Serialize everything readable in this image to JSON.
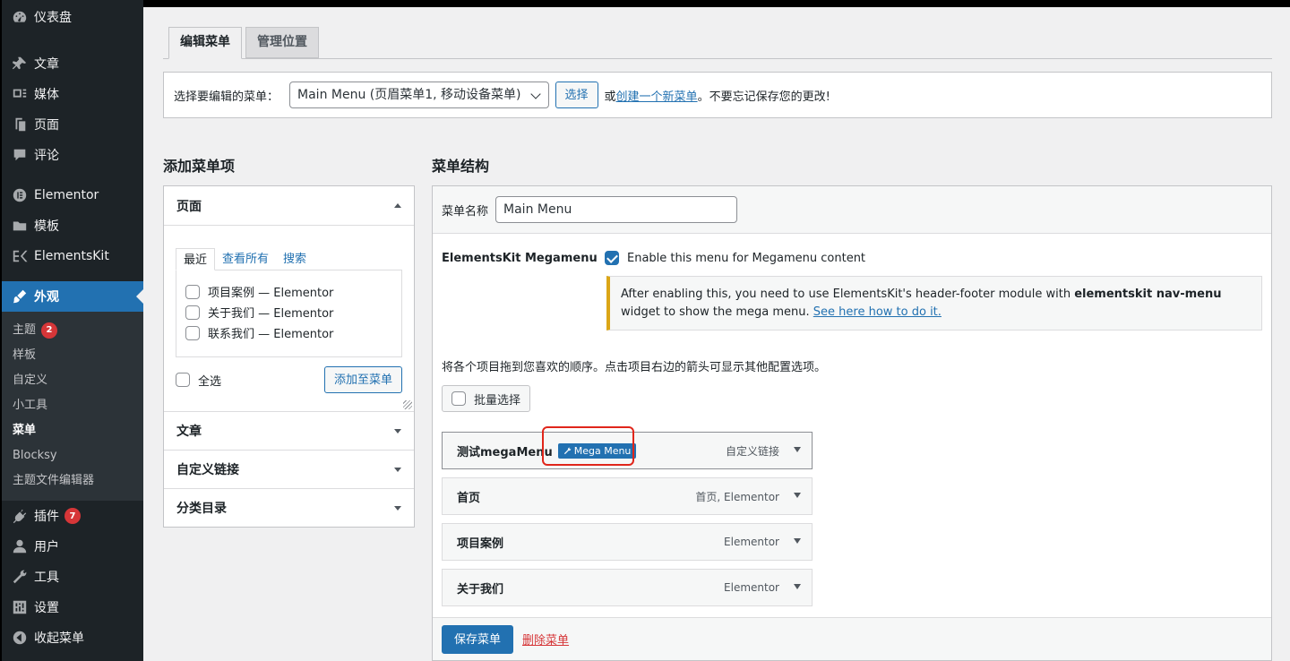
{
  "sidebar": {
    "items": [
      {
        "label": "仪表盘",
        "icon": "dashboard-icon"
      },
      {
        "label": "文章",
        "icon": "pin-icon"
      },
      {
        "label": "媒体",
        "icon": "media-icon"
      },
      {
        "label": "页面",
        "icon": "page-icon"
      },
      {
        "label": "评论",
        "icon": "comment-icon"
      },
      {
        "label": "Elementor",
        "icon": "elementor-icon"
      },
      {
        "label": "模板",
        "icon": "folder-icon"
      },
      {
        "label": "ElementsKit",
        "icon": "elementskit-icon"
      },
      {
        "label": "外观",
        "icon": "brush-icon"
      }
    ],
    "submenu": [
      {
        "label": "主题",
        "badge": "2"
      },
      {
        "label": "样板"
      },
      {
        "label": "自定义"
      },
      {
        "label": "小工具"
      },
      {
        "label": "菜单"
      },
      {
        "label": "Blocksy"
      },
      {
        "label": "主题文件编辑器"
      }
    ],
    "bottom_items": [
      {
        "label": "插件",
        "icon": "plugin-icon",
        "badge": "7"
      },
      {
        "label": "用户",
        "icon": "user-icon"
      },
      {
        "label": "工具",
        "icon": "wrench-icon"
      },
      {
        "label": "设置",
        "icon": "settings-icon"
      },
      {
        "label": "收起菜单",
        "icon": "collapse-icon"
      }
    ]
  },
  "tabs": {
    "edit": "编辑菜单",
    "locations": "管理位置"
  },
  "select_menu": {
    "label": "选择要编辑的菜单：",
    "value": "Main Menu (页眉菜单1, 移动设备菜单)",
    "button": "选择",
    "or": "或",
    "create_link": "创建一个新菜单",
    "tail": "。不要忘记保存您的更改!"
  },
  "add_items": {
    "title": "添加菜单项",
    "pages_title": "页面",
    "inner_tabs": [
      "最近",
      "查看所有",
      "搜索"
    ],
    "pages": [
      "项目案例 — Elementor",
      "关于我们 — Elementor",
      "联系我们 — Elementor"
    ],
    "select_all": "全选",
    "add_button": "添加至菜单",
    "sections": [
      "文章",
      "自定义链接",
      "分类目录"
    ]
  },
  "structure": {
    "title": "菜单结构",
    "name_label": "菜单名称",
    "name_value": "Main Menu",
    "ek_label": "ElementsKit Megamenu",
    "ek_checkbox": "Enable this menu for Megamenu content",
    "notice_1": "After enabling this, you need to use ElementsKit's header-footer module with ",
    "notice_bold": "elementskit nav-menu",
    "notice_2": " widget to show the mega menu. ",
    "notice_link": "See here how to do it.",
    "drag_hint": "将各个项目拖到您喜欢的顺序。点击项目右边的箭头可显示其他配置选项。",
    "bulk_select": "批量选择",
    "items": [
      {
        "title": "测试megaMenu",
        "badge": "Mega Menu",
        "type": "自定义链接"
      },
      {
        "title": "首页",
        "type": "首页, Elementor"
      },
      {
        "title": "项目案例",
        "type": "Elementor"
      },
      {
        "title": "关于我们",
        "type": "Elementor"
      }
    ],
    "save": "保存菜单",
    "delete": "删除菜单"
  }
}
